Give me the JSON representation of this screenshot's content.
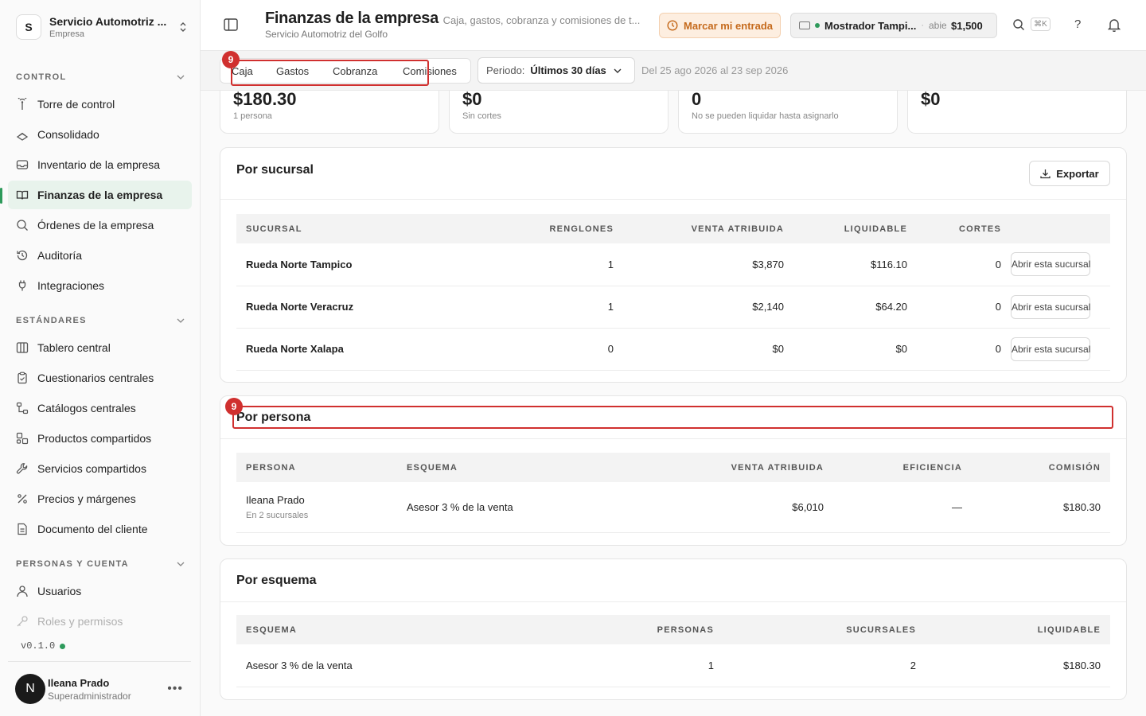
{
  "workspace": {
    "initial": "S",
    "name": "Servicio Automotriz ...",
    "type": "Empresa"
  },
  "sidebar": {
    "sections": [
      {
        "label": "CONTROL"
      },
      {
        "label": "ESTÁNDARES"
      },
      {
        "label": "PERSONAS Y CUENTA"
      }
    ],
    "items": [
      {
        "label": "Torre de control",
        "icon": "tower-icon"
      },
      {
        "label": "Consolidado",
        "icon": "layers-icon"
      },
      {
        "label": "Inventario de la empresa",
        "icon": "inbox-icon"
      },
      {
        "label": "Finanzas de la empresa",
        "icon": "book-icon"
      },
      {
        "label": "Órdenes de la empresa",
        "icon": "search-icon"
      },
      {
        "label": "Auditoría",
        "icon": "history-icon"
      },
      {
        "label": "Integraciones",
        "icon": "plug-icon"
      },
      {
        "label": "Tablero central",
        "icon": "columns-icon"
      },
      {
        "label": "Cuestionarios centrales",
        "icon": "clipboard-icon"
      },
      {
        "label": "Catálogos centrales",
        "icon": "hierarchy-icon"
      },
      {
        "label": "Productos compartidos",
        "icon": "boxes-icon"
      },
      {
        "label": "Servicios compartidos",
        "icon": "wrench-icon"
      },
      {
        "label": "Precios y márgenes",
        "icon": "percent-icon"
      },
      {
        "label": "Documento del cliente",
        "icon": "document-icon"
      },
      {
        "label": "Usuarios",
        "icon": "user-icon"
      },
      {
        "label": "Roles y permisos",
        "icon": "key-icon"
      }
    ],
    "version": "v0.1.0"
  },
  "user": {
    "initial": "N",
    "name": "Ileana Prado",
    "role": "Superadministrador"
  },
  "header": {
    "title": "Finanzas de la empresa",
    "subtitle": "Servicio Automotriz del Golfo",
    "description": "Caja, gastos, cobranza y comisiones de t...",
    "clock_in_label": "Marcar mi entrada",
    "counter_name": "Mostrador Tampi...",
    "counter_sep": "·",
    "counter_state": "abierta",
    "counter_amount": "$1,500",
    "shortcut": "⌘K",
    "help": "?"
  },
  "tabs": [
    "Caja",
    "Gastos",
    "Cobranza",
    "Comisiones"
  ],
  "period": {
    "label": "Periodo:",
    "value": "Últimos 30 días"
  },
  "date_range": "Del 25 ago 2026 al 23 sep 2026",
  "annotations": {
    "badge_1": "9",
    "badge_2": "9"
  },
  "kpis": [
    {
      "value": "$180.30",
      "sub": "1 persona"
    },
    {
      "value": "$0",
      "sub": "Sin cortes"
    },
    {
      "value": "0",
      "sub": "No se pueden liquidar hasta asignarlo"
    },
    {
      "value": "$0",
      "sub": ""
    }
  ],
  "branch_card": {
    "title": "Por sucursal",
    "export_label": "Exportar",
    "columns": [
      "SUCURSAL",
      "RENGLONES",
      "VENTA ATRIBUIDA",
      "LIQUIDABLE",
      "CORTES"
    ],
    "rows": [
      {
        "name": "Rueda Norte Tampico",
        "lines": "1",
        "sales": "$3,870",
        "settle": "$116.10",
        "cuts": "0",
        "action": "Abrir esta sucursal"
      },
      {
        "name": "Rueda Norte Veracruz",
        "lines": "1",
        "sales": "$2,140",
        "settle": "$64.20",
        "cuts": "0",
        "action": "Abrir esta sucursal"
      },
      {
        "name": "Rueda Norte Xalapa",
        "lines": "0",
        "sales": "$0",
        "settle": "$0",
        "cuts": "0",
        "action": "Abrir esta sucursal"
      }
    ]
  },
  "person_card": {
    "title": "Por persona",
    "columns": [
      "PERSONA",
      "ESQUEMA",
      "VENTA ATRIBUIDA",
      "EFICIENCIA",
      "COMISIÓN"
    ],
    "rows": [
      {
        "name": "Ileana Prado",
        "sub": "En 2 sucursales",
        "scheme": "Asesor 3 % de la venta",
        "sales": "$6,010",
        "efficiency": "—",
        "commission": "$180.30"
      }
    ]
  },
  "scheme_card": {
    "title": "Por esquema",
    "columns": [
      "ESQUEMA",
      "PERSONAS",
      "SUCURSALES",
      "LIQUIDABLE"
    ],
    "rows": [
      {
        "scheme": "Asesor 3 % de la venta",
        "people": "1",
        "branches": "2",
        "settle": "$180.30"
      }
    ]
  }
}
